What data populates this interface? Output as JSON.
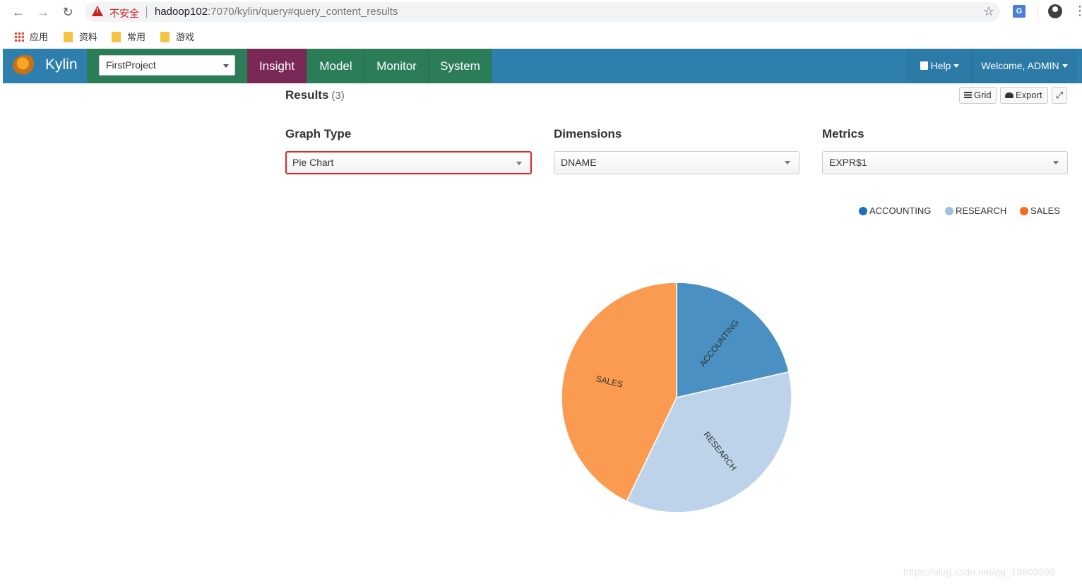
{
  "browser": {
    "insecure_label": "不安全",
    "url_host": "hadoop102",
    "url_rest": ":7070/kylin/query#query_content_results",
    "bookmarks": [
      "应用",
      "资料",
      "常用",
      "游戏"
    ]
  },
  "header": {
    "brand": "Kylin",
    "project": "FirstProject",
    "tabs": [
      "Insight",
      "Model",
      "Monitor",
      "System"
    ],
    "help": "Help",
    "welcome": "Welcome, ADMIN"
  },
  "results": {
    "title": "Results",
    "count": "(3)",
    "grid_label": "Grid",
    "export_label": "Export"
  },
  "controls": {
    "graph_type_label": "Graph Type",
    "graph_type_value": "Pie Chart",
    "dimensions_label": "Dimensions",
    "dimensions_value": "DNAME",
    "metrics_label": "Metrics",
    "metrics_value": "EXPR$1"
  },
  "chart_data": {
    "type": "pie",
    "categories": [
      "ACCOUNTING",
      "RESEARCH",
      "SALES"
    ],
    "values": [
      3,
      5,
      6
    ],
    "colors": [
      "#4a90c2",
      "#bcd3ea",
      "#fb9a51"
    ],
    "legend_colors": [
      "#1f6fb5",
      "#9fbfe0",
      "#f26c1c"
    ],
    "legend_position": "top-right"
  },
  "watermark": "https://blog.csdn.net/qq_18603599"
}
